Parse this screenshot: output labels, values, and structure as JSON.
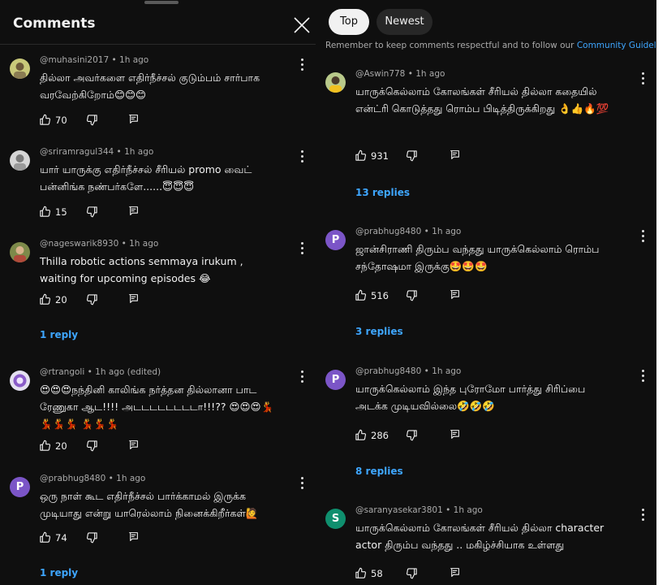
{
  "left": {
    "title": "Comments",
    "comments": [
      {
        "author": "@muhasini2017",
        "time": "1h ago",
        "text": "தில்லா அவர்களை எதிர்நீச்சல் குடும்பம் சார்பாக வரவேற்கிறோம்😊😊😊",
        "likes": "70"
      },
      {
        "author": "@sriramragul344",
        "time": "1h ago",
        "text": "யார் யாருக்கு எதிர்நீச்சல் சீரியல் promo வைட் பன்னிங்க நண்பர்களே......😇😇😇",
        "likes": "15"
      },
      {
        "author": "@nageswarik8930",
        "time": "1h ago",
        "text": "Thilla robotic actions semmaya irukum , waiting for upcoming episodes 😂",
        "likes": "20",
        "replies": "1 reply"
      },
      {
        "author": "@rtrangoli",
        "time": "1h ago (edited)",
        "text": "😍😍😍நந்தினி காலிங்க நர்த்தன தில்லானா பாட ரேணுகா ஆட!!!! அடடடடடடடடா!!!?? 😍😍😍💃💃💃💃 💃💃💃",
        "likes": "20"
      },
      {
        "author": "@prabhug8480",
        "time": "1h ago",
        "avatar_letter": "P",
        "text": "ஒரு நாள் கூட எதிர்நீச்சல் பார்க்காமல் இருக்க முடியாது என்று யாரெல்லாம் நினைக்கிறீர்கள்🙋",
        "likes": "74",
        "replies": "1 reply"
      }
    ]
  },
  "right": {
    "tabs": {
      "top": "Top",
      "newest": "Newest"
    },
    "notice": {
      "text": "Remember to keep comments respectful and to follow our ",
      "link": "Community Guidelines"
    },
    "comments": [
      {
        "author": "@Aswin778",
        "time": "1h ago",
        "text": "யாருக்கெல்லாம் கோலங்கள் சீரியல் தில்லா கதையில் என்ட்ரி கொடுத்தது ரொம்ப பிடித்திருக்கிறது 👌👍🔥💯",
        "likes": "931",
        "replies": "13 replies"
      },
      {
        "author": "@prabhug8480",
        "time": "1h ago",
        "avatar_letter": "P",
        "text": "ஜான்சிராணி திரும்ப வந்தது யாருக்கெல்லாம் ரொம்ப சந்தோஷமா இருக்கு🤩🤩🤩",
        "likes": "516",
        "replies": "3 replies"
      },
      {
        "author": "@prabhug8480",
        "time": "1h ago",
        "avatar_letter": "P",
        "text": "யாருக்கெல்லாம் இந்த புரோமோ பார்த்து சிரிப்பை அடக்க முடியவில்லை🤣🤣🤣",
        "likes": "286",
        "replies": "8 replies"
      },
      {
        "author": "@saranyasekar3801",
        "time": "1h ago",
        "avatar_letter": "S",
        "text": "யாருக்கெல்லாம் கோலங்கள் சீரியல் தில்லா character actor  திரும்ப வந்தது .. மகிழ்ச்சியாக உள்ளது",
        "likes": "58"
      }
    ]
  }
}
